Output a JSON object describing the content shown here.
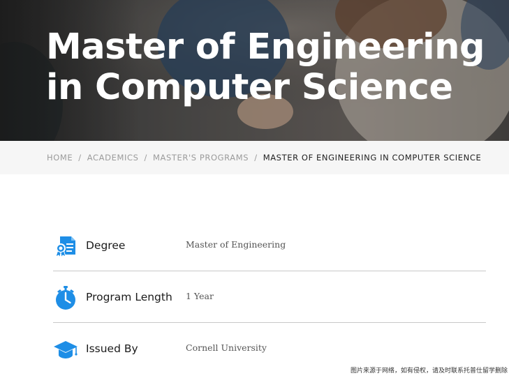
{
  "hero": {
    "title": "Master of Engineering in Computer Science"
  },
  "breadcrumb": {
    "items": [
      "HOME",
      "ACADEMICS",
      "MASTER'S PROGRAMS"
    ],
    "separator": "/",
    "current": "MASTER OF ENGINEERING IN COMPUTER SCIENCE"
  },
  "details": [
    {
      "label": "Degree",
      "value": "Master of Engineering",
      "icon": "certificate-icon"
    },
    {
      "label": "Program Length",
      "value": "1 Year",
      "icon": "stopwatch-icon"
    },
    {
      "label": "Issued By",
      "value": "Cornell University",
      "icon": "graduation-cap-icon"
    }
  ],
  "watermark": "图片来源于网络，如有侵权，请及时联系托普仕留学删除",
  "colors": {
    "icon_blue": "#1e8ee6",
    "breadcrumb_bg": "#f6f6f6",
    "divider": "#c8c8c8"
  }
}
